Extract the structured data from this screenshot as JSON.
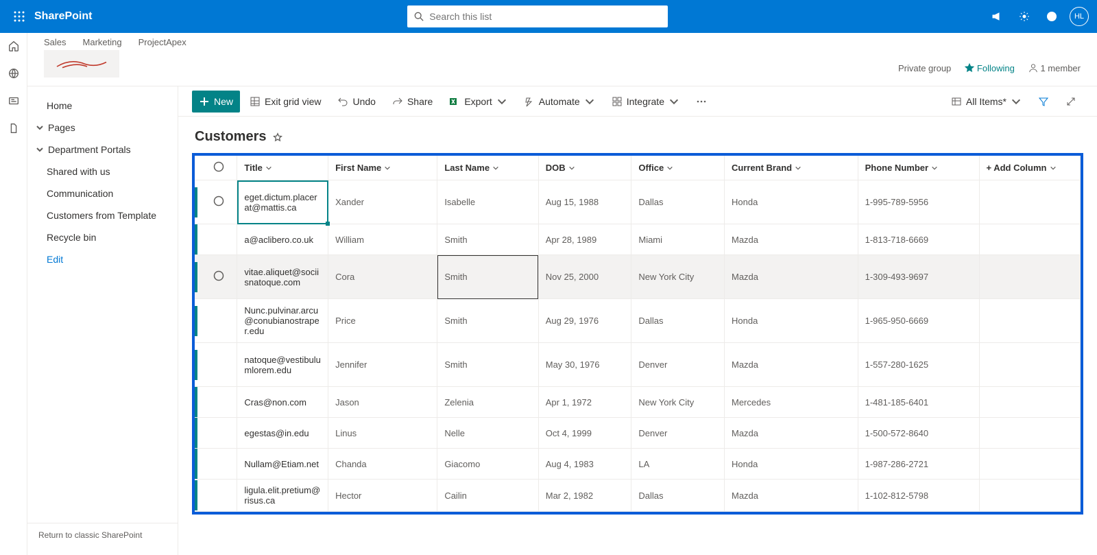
{
  "appbar": {
    "brand": "SharePoint",
    "search_placeholder": "Search this list",
    "avatar": "HL"
  },
  "hub_links": [
    "Sales",
    "Marketing",
    "ProjectApex"
  ],
  "site_meta": {
    "privacy": "Private group",
    "following": "Following",
    "members": "1 member"
  },
  "leftnav": {
    "home": "Home",
    "pages": "Pages",
    "portals": "Department Portals",
    "shared": "Shared with us",
    "comm": "Communication",
    "cft": "Customers from Template",
    "recycle": "Recycle bin",
    "edit": "Edit",
    "classic": "Return to classic SharePoint"
  },
  "cmdbar": {
    "new": "New",
    "exit": "Exit grid view",
    "undo": "Undo",
    "share": "Share",
    "export": "Export",
    "automate": "Automate",
    "integrate": "Integrate",
    "allitems": "All Items*"
  },
  "list_title": "Customers",
  "columns": {
    "title": "Title",
    "first": "First Name",
    "last": "Last Name",
    "dob": "DOB",
    "office": "Office",
    "brand": "Current Brand",
    "phone": "Phone Number",
    "add": "+ Add Column"
  },
  "rows": [
    {
      "title": "eget.dictum.placerat@mattis.ca",
      "first": "Xander",
      "last": "Isabelle",
      "dob": "Aug 15, 1988",
      "office": "Dallas",
      "brand": "Honda",
      "phone": "1-995-789-5956"
    },
    {
      "title": "a@aclibero.co.uk",
      "first": "William",
      "last": "Smith",
      "dob": "Apr 28, 1989",
      "office": "Miami",
      "brand": "Mazda",
      "phone": "1-813-718-6669"
    },
    {
      "title": "vitae.aliquet@sociisnatoque.com",
      "first": "Cora",
      "last": "Smith",
      "dob": "Nov 25, 2000",
      "office": "New York City",
      "brand": "Mazda",
      "phone": "1-309-493-9697"
    },
    {
      "title": "Nunc.pulvinar.arcu@conubianostraper.edu",
      "first": "Price",
      "last": "Smith",
      "dob": "Aug 29, 1976",
      "office": "Dallas",
      "brand": "Honda",
      "phone": "1-965-950-6669"
    },
    {
      "title": "natoque@vestibulumlorem.edu",
      "first": "Jennifer",
      "last": "Smith",
      "dob": "May 30, 1976",
      "office": "Denver",
      "brand": "Mazda",
      "phone": "1-557-280-1625"
    },
    {
      "title": "Cras@non.com",
      "first": "Jason",
      "last": "Zelenia",
      "dob": "Apr 1, 1972",
      "office": "New York City",
      "brand": "Mercedes",
      "phone": "1-481-185-6401"
    },
    {
      "title": "egestas@in.edu",
      "first": "Linus",
      "last": "Nelle",
      "dob": "Oct 4, 1999",
      "office": "Denver",
      "brand": "Mazda",
      "phone": "1-500-572-8640"
    },
    {
      "title": "Nullam@Etiam.net",
      "first": "Chanda",
      "last": "Giacomo",
      "dob": "Aug 4, 1983",
      "office": "LA",
      "brand": "Honda",
      "phone": "1-987-286-2721"
    },
    {
      "title": "ligula.elit.pretium@risus.ca",
      "first": "Hector",
      "last": "Cailin",
      "dob": "Mar 2, 1982",
      "office": "Dallas",
      "brand": "Mazda",
      "phone": "1-102-812-5798"
    }
  ],
  "active_cell": {
    "row": 0,
    "col": "title"
  },
  "editing_cell": {
    "row": 2,
    "col": "last"
  }
}
